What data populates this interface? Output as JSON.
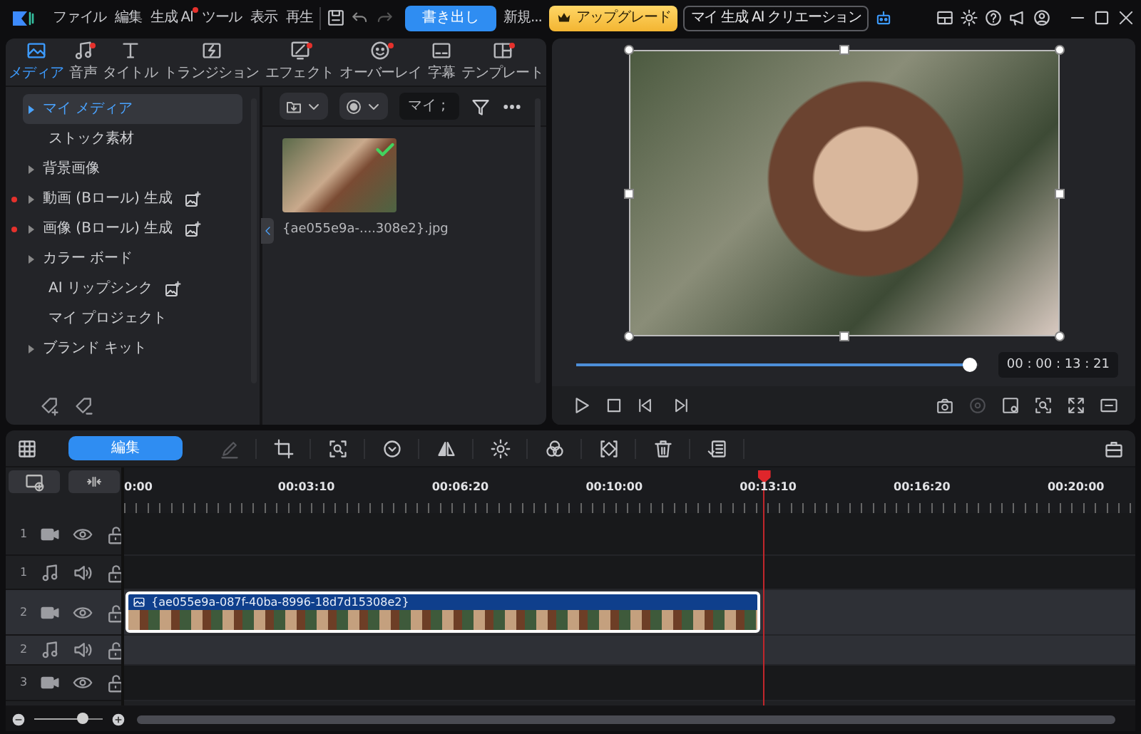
{
  "menu_bar": {
    "items": [
      {
        "label": "ファイル",
        "dot": false
      },
      {
        "label": "編集",
        "dot": false
      },
      {
        "label": "生成 AI",
        "dot": true
      },
      {
        "label": "ツール",
        "dot": false
      },
      {
        "label": "表示",
        "dot": false
      },
      {
        "label": "再生",
        "dot": false
      }
    ],
    "export_button": "書き出し",
    "new_label": "新規...",
    "upgrade_button": "アップグレード",
    "ai_creations_button": "マイ 生成 AI クリエーション"
  },
  "media_tabs": [
    {
      "label": "メディア",
      "selected": true,
      "dot": false
    },
    {
      "label": "音声",
      "selected": false,
      "dot": true
    },
    {
      "label": "タイトル",
      "selected": false,
      "dot": false
    },
    {
      "label": "トランジション",
      "selected": false,
      "dot": false
    },
    {
      "label": "エフェクト",
      "selected": false,
      "dot": true
    },
    {
      "label": "オーバーレイ",
      "selected": false,
      "dot": true
    },
    {
      "label": "字幕",
      "selected": false,
      "dot": false
    },
    {
      "label": "テンプレート",
      "selected": false,
      "dot": true
    }
  ],
  "sidebar": {
    "items": [
      {
        "label": "マイ メディア",
        "selected": true,
        "expandable": true,
        "dot": false,
        "ai_badge": false
      },
      {
        "label": "ストック素材",
        "selected": false,
        "expandable": false,
        "dot": false,
        "ai_badge": false
      },
      {
        "label": "背景画像",
        "selected": false,
        "expandable": true,
        "dot": false,
        "ai_badge": false
      },
      {
        "label": "動画 (Bロール) 生成",
        "selected": false,
        "expandable": true,
        "dot": true,
        "ai_badge": true
      },
      {
        "label": "画像 (Bロール) 生成",
        "selected": false,
        "expandable": true,
        "dot": true,
        "ai_badge": true
      },
      {
        "label": "カラー ボード",
        "selected": false,
        "expandable": true,
        "dot": false,
        "ai_badge": false
      },
      {
        "label": "AI リップシンク",
        "selected": false,
        "expandable": false,
        "dot": false,
        "ai_badge": true
      },
      {
        "label": "マイ プロジェクト",
        "selected": false,
        "expandable": false,
        "dot": false,
        "ai_badge": false
      },
      {
        "label": "ブランド キット",
        "selected": false,
        "expandable": true,
        "dot": false,
        "ai_badge": false
      }
    ]
  },
  "media_panel": {
    "search": {
      "placeholder": "マイ ;"
    },
    "files": [
      {
        "name": "{ae055e9a-....308e2}.jpg",
        "in_timeline": true
      }
    ]
  },
  "preview": {
    "scrubber": {
      "level": 0.98
    },
    "timecode": "00 : 00 : 13 : 21",
    "record_button": {
      "disabled": true
    }
  },
  "timeline": {
    "edit_button": "編集",
    "tools": [
      {
        "disabled": true
      },
      {
        "disabled": false
      },
      {
        "disabled": false
      },
      {
        "disabled": false
      },
      {
        "disabled": false
      },
      {
        "disabled": false
      },
      {
        "disabled": false
      },
      {
        "disabled": false
      },
      {
        "disabled": false
      },
      {
        "disabled": false
      }
    ],
    "ruler_labels": [
      "0:00",
      "00:03:10",
      "00:06:20",
      "00:10:00",
      "00:13:10",
      "00:16:20",
      "00:20:00"
    ],
    "playhead": {
      "level": 0.633
    },
    "tracks": [
      {
        "number": "1",
        "kind": "video",
        "selected": false
      },
      {
        "number": "1",
        "kind": "audio",
        "selected": false
      },
      {
        "number": "2",
        "kind": "video",
        "selected": true,
        "clips": [
          {
            "name": "{ae055e9a-087f-40ba-8996-18d7d15308e2}",
            "selected": true
          }
        ]
      },
      {
        "number": "2",
        "kind": "audio",
        "selected": true
      },
      {
        "number": "3",
        "kind": "video",
        "selected": false
      }
    ],
    "zoom": {
      "level": 0.7
    }
  }
}
